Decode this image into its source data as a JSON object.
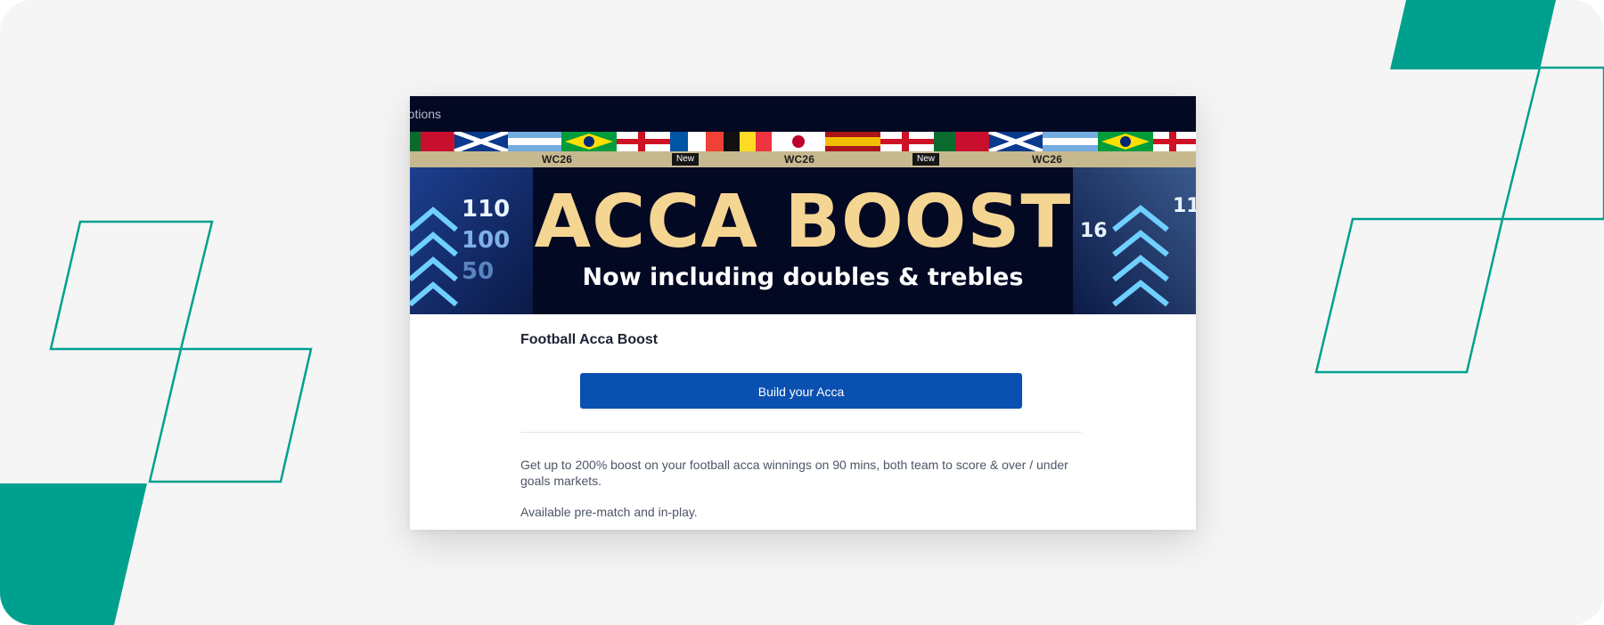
{
  "topbar": {
    "link_label": "motions"
  },
  "strip": {
    "wc_label": "WC26",
    "new_badge": "New"
  },
  "banner": {
    "title": "ACCA BOOST",
    "subtitle": "Now including doubles & trebles"
  },
  "promo": {
    "heading": "Football Acca Boost",
    "button_label": "Build your Acca",
    "description": "Get up to 200% boost on your football acca winnings on 90 mins, both team to score & over / under goals markets.",
    "availability": "Available pre-match and in-play."
  },
  "colors": {
    "accent": "#0a50b0",
    "brand_teal": "#00a08f",
    "banner_navy": "#030823",
    "banner_gold": "#f4d592"
  }
}
